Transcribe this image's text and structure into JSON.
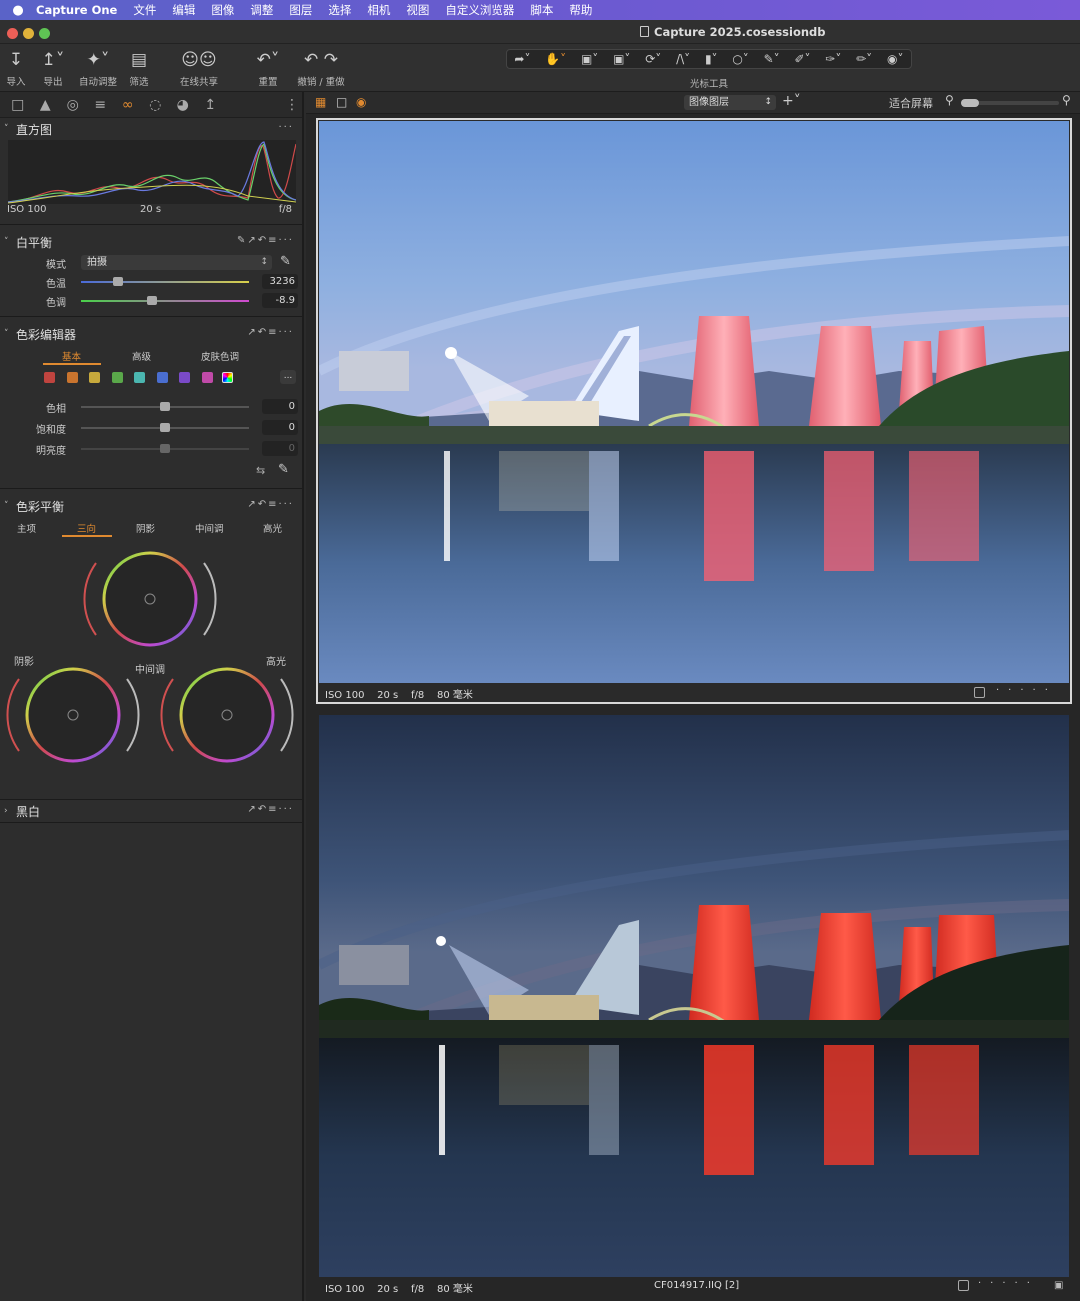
{
  "menubar": {
    "apple": "",
    "app_name": "Capture One",
    "items": [
      "文件",
      "编辑",
      "图像",
      "调整",
      "图层",
      "选择",
      "相机",
      "视图",
      "自定义浏览器",
      "脚本",
      "帮助"
    ]
  },
  "window": {
    "title": "Capture 2025.cosessiondb"
  },
  "toolbar": {
    "import": "导入",
    "export": "导出",
    "auto_adjust": "自动调整",
    "filter": "筛选",
    "share": "在线共享",
    "reset": "重置",
    "undo_redo": "撤销 / 重做",
    "cursor_tools": "光标工具"
  },
  "histogram": {
    "title": "直方图",
    "iso": "ISO 100",
    "shutter": "20 s",
    "aperture": "f/8"
  },
  "white_balance": {
    "title": "白平衡",
    "mode_label": "模式",
    "mode_value": "拍摄",
    "temp_label": "色温",
    "temp_value": "3236",
    "temp_pos": 0.2,
    "tint_label": "色调",
    "tint_value": "-8.9",
    "tint_pos": 0.42
  },
  "color_editor": {
    "title": "色彩编辑器",
    "tabs": [
      "基本",
      "高级",
      "皮肤色调"
    ],
    "swatch_colors": [
      "#c0443f",
      "#c9742e",
      "#c7a93c",
      "#5aa84a",
      "#4bb6b0",
      "#4a6ed0",
      "#7a4ac8",
      "#c04aa8"
    ],
    "more": "...",
    "hue_label": "色相",
    "hue_value": "0",
    "sat_label": "饱和度",
    "sat_value": "0",
    "light_label": "明亮度",
    "light_value": "0"
  },
  "color_balance": {
    "title": "色彩平衡",
    "tabs": [
      "主项",
      "三向",
      "阴影",
      "中间调",
      "高光"
    ],
    "shadow_label": "阴影",
    "midtone_label": "中间调",
    "highlight_label": "高光"
  },
  "bw": {
    "title": "黑白"
  },
  "viewer": {
    "layer_select": "图像图层",
    "fit": "适合屏幕",
    "top": {
      "iso": "ISO 100",
      "shutter": "20 s",
      "aperture": "f/8",
      "focal": "80 毫米"
    },
    "bottom": {
      "iso": "ISO 100",
      "shutter": "20 s",
      "aperture": "f/8",
      "focal": "80 毫米",
      "filename": "CF014917.IIQ [2]"
    }
  }
}
